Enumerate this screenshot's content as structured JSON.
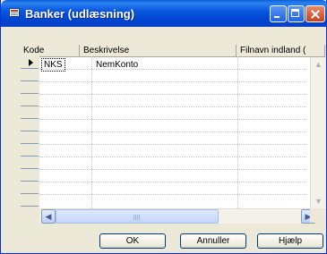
{
  "window": {
    "title": "Banker (udlæsning)",
    "title_icon": "grid-window-icon",
    "controls": {
      "minimize": "minimize-icon",
      "maximize": "maximize-icon",
      "close": "close-icon"
    }
  },
  "table": {
    "columns": [
      "Kode",
      "Beskrivelse",
      "Filnavn indland ("
    ],
    "rows": [
      {
        "kode": "NKS",
        "beskrivelse": "NemKonto",
        "filnavn": ""
      }
    ]
  },
  "scrollbars": {
    "vertical": {
      "up": "scroll-up-arrow-icon",
      "down": "scroll-down-arrow-icon"
    },
    "horizontal": {
      "left": "scroll-left-arrow-icon",
      "right": "scroll-right-arrow-icon"
    }
  },
  "buttons": {
    "ok": "OK",
    "cancel": "Annuller",
    "help": "Hjælp"
  }
}
